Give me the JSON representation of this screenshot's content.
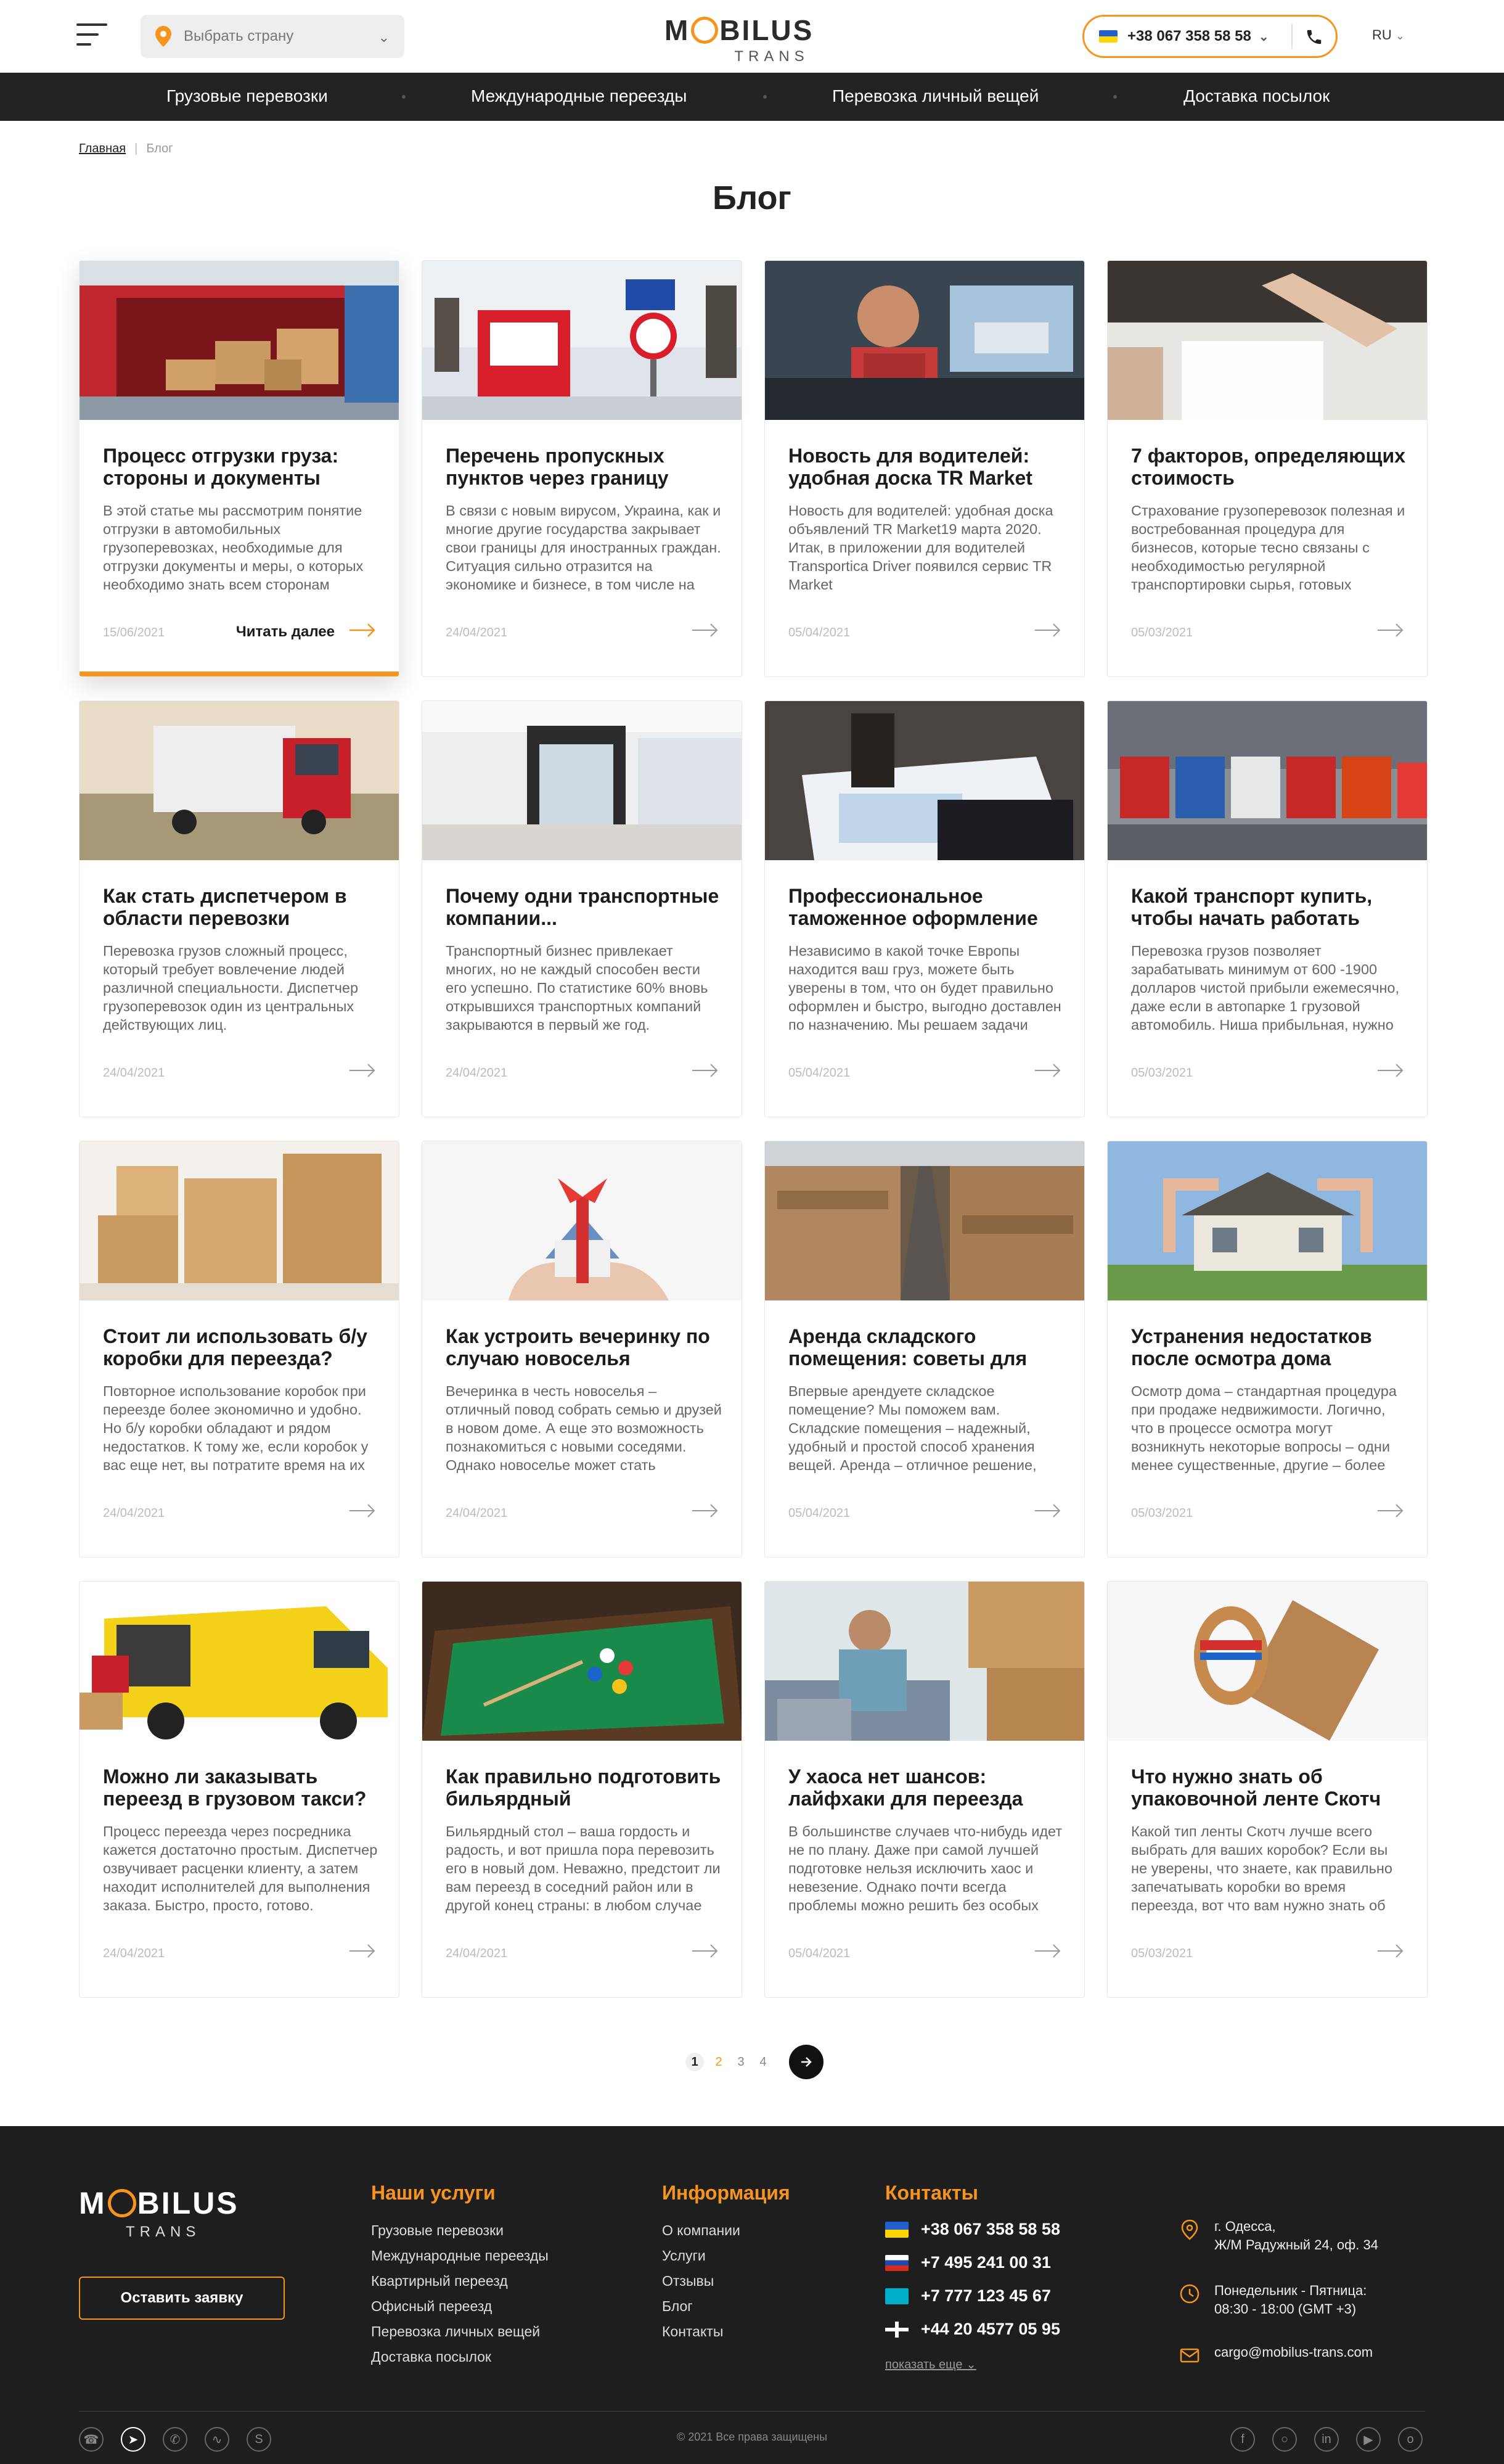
{
  "header": {
    "country_placeholder": "Выбрать страну",
    "phone": "+38 067 358 58 58",
    "lang": "RU",
    "logo_main": "BILUS",
    "logo_m": "M",
    "logo_sub": "TRANS"
  },
  "nav": [
    "Грузовые перевозки",
    "Международные переезды",
    "Перевозка личный вещей",
    "Доставка посылок"
  ],
  "breadcrumb": {
    "home": "Главная",
    "sep": "|",
    "current": "Блог"
  },
  "page_title": "Блог",
  "read_more": "Читать далее",
  "posts": [
    {
      "title": "Процесс отгрузки груза: стороны и документы",
      "excerpt": "В этой статье мы рассмотрим понятие отгрузки в автомобильных грузоперевозках, необходимые для отгрузки документы и меры, о которых необходимо знать всем сторонам грузоперевозки.",
      "date": "15/06/2021",
      "image": "red-container-boxes"
    },
    {
      "title": "Перечень пропускных пунктов через границу",
      "excerpt": "В связи с новым вирусом, Украина, как и многие другие государства закрывает свои границы для иностранных граждан. Ситуация сильно отразится на экономике и бизнесе, в том числе на сфере",
      "date": "24/04/2021",
      "image": "polska-border-sign"
    },
    {
      "title": "Новость для водителей: удобная доска TR Market",
      "excerpt": "Новость для водителей: удобная доска объявлений TR Market19 марта 2020. Итак, в приложении для водителей Transportica Driver появился сервис TR Market",
      "date": "05/04/2021",
      "image": "truck-driver"
    },
    {
      "title": "7 факторов, определяющих стоимость",
      "excerpt": "Страхование грузоперевозок полезная и востребованная процедура для бизнесов, которые тесно связаны с необходимостью регулярной транспортировки сырья, готовых товаров конечному",
      "date": "05/03/2021",
      "image": "signing-document"
    },
    {
      "title": "Как стать диспетчером в области перевозки",
      "excerpt": "Перевозка грузов сложный процесс, который требует вовлечение людей различной специальности. Диспетчер грузоперевозок один из центральных действующих лиц.",
      "date": "24/04/2021",
      "image": "red-truck-road"
    },
    {
      "title": "Почему одни транспортные компании...",
      "excerpt": "Транспортный бизнес привлекает многих, но не каждый способен вести его успешно. По статистике 60% вновь открывшихся транспортных компаний закрываются в первый же год.",
      "date": "24/04/2021",
      "image": "office-interior"
    },
    {
      "title": "Профессиональное таможенное оформление",
      "excerpt": "Независимо в какой точке Европы находится ваш груз, можете быть уверены в том, что он будет правильно оформлен и быстро, выгодно доставлен по назначению. Мы решаем задачи любой...",
      "date": "05/04/2021",
      "image": "stamp-document"
    },
    {
      "title": "Какой транспорт купить, чтобы начать работать",
      "excerpt": "Перевозка грузов позволяет зарабатывать минимум от 600 -1900 долларов чистой прибыли ежемесячно, даже если в автопарке 1 грузовой автомобиль. Ниша прибыльная, нужно только грамотно",
      "date": "05/03/2021",
      "image": "truck-fleet"
    },
    {
      "title": "Стоит ли использовать б/у коробки для переезда?",
      "excerpt": "Повторное использование коробок при переезде более экономично и удобно. Но б/у коробки обладают и рядом недостатков. К тому же, если коробок у вас еще нет, вы потратите время на их поиски",
      "date": "24/04/2021",
      "image": "cardboard-boxes"
    },
    {
      "title": "Как устроить вечеринку по случаю новоселья",
      "excerpt": "Вечеринка в честь новоселья – отличный повод собрать семью и друзей в новом доме. А еще это возможность познакомиться с новыми соседями. Однако новоселье может стать непосильной",
      "date": "24/04/2021",
      "image": "house-gift"
    },
    {
      "title": "Аренда складского помещения: советы для",
      "excerpt": "Впервые арендуете складское помещение? Мы поможем вам. Складские помещения – надежный, удобный и простой способ хранения вещей. Аренда – отличное решение, если нужно хранилище",
      "date": "05/04/2021",
      "image": "warehouse"
    },
    {
      "title": "Устранения недостатков после осмотра дома",
      "excerpt": "Осмотр дома – стандартная процедура при продаже недвижимости. Логично, что в процессе осмотра могут возникнуть некоторые вопросы – одни менее существенные, другие – более",
      "date": "05/03/2021",
      "image": "house-frame"
    },
    {
      "title": "Можно ли заказывать переезд в грузовом такси?",
      "excerpt": "Процесс переезда через посредника кажется достаточно простым. Диспетчер озвучивает расценки клиенту, а затем находит исполнителей для выполнения заказа. Быстро, просто, готово.",
      "date": "24/04/2021",
      "image": "yellow-van"
    },
    {
      "title": "Как правильно подготовить бильярдный",
      "excerpt": "Бильярдный стол – ваша гордость и радость, и вот пришла пора перевозить его в новый дом. Неважно, предстоит ли вам переезд в соседний район или в другой конец страны: в любом случае",
      "date": "24/04/2021",
      "image": "billiard-table"
    },
    {
      "title": "У хаоса нет шансов: лайфхаки для переезда",
      "excerpt": "В большинстве случаев что-нибудь идет не по плану. Даже при самой лучшей подготовке нельзя исключить хаос и невезение. Однако почти всегда проблемы можно решить без особых усилий",
      "date": "05/04/2021",
      "image": "woman-boxes"
    },
    {
      "title": "Что нужно знать об упаковочной ленте Скотч",
      "excerpt": "Какой тип ленты Скотч лучше всего выбрать для ваших коробок? Если вы не уверены, что знаете, как правильно запечатывать коробки во время переезда, вот что вам нужно знать об этом важном материале",
      "date": "05/03/2021",
      "image": "packing-tape"
    }
  ],
  "pagination": {
    "pages": [
      "1",
      "2",
      "3",
      "4"
    ],
    "current": "1"
  },
  "footer": {
    "cta": "Оставить заявку",
    "services_title": "Наши услуги",
    "services": [
      "Грузовые перевозки",
      "Международные переезды",
      "Квартирный переезд",
      "Офисный переезд",
      "Перевозка личных вещей",
      "Доставка посылок"
    ],
    "info_title": "Информация",
    "info": [
      "О компании",
      "Услуги",
      "Отзывы",
      "Блог",
      "Контакты"
    ],
    "contacts_title": "Контакты",
    "phones": [
      "+38 067 358 58 58",
      "+7 495 241 00 31",
      "+7 777 123 45 67",
      "+44 20 4577 05 95"
    ],
    "show_more": "показать еще",
    "address_city": "г. Одесса,",
    "address_street": "Ж/М Радужный 24, оф. 34",
    "hours_days": "Понедельник - Пятница:",
    "hours_time": "08:30 - 18:00 (GMT +3)",
    "email": "cargo@mobilus-trans.com",
    "copyright": "© 2021 Все права защищены"
  },
  "colors": {
    "accent": "#f7941d",
    "dark": "#1e1e1e",
    "nav": "#222222"
  }
}
